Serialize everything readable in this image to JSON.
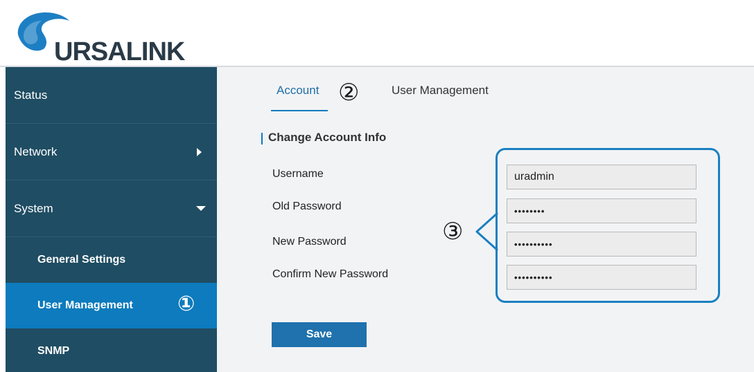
{
  "brand": {
    "logo_text": "URSALINK"
  },
  "sidebar": {
    "items": [
      {
        "label": "Status"
      },
      {
        "label": "Network"
      },
      {
        "label": "System"
      },
      {
        "label": "General Settings"
      },
      {
        "label": "User Management"
      },
      {
        "label": "SNMP"
      }
    ],
    "marker": "①"
  },
  "tabs": {
    "items": [
      {
        "label": "Account"
      },
      {
        "label": "User Management"
      }
    ],
    "marker": "②"
  },
  "account_form": {
    "title": "Change Account Info",
    "fields": [
      {
        "label": "Username",
        "value": "uradmin"
      },
      {
        "label": "Old Password",
        "value": "••••••••"
      },
      {
        "label": "New Password",
        "value": "••••••••••"
      },
      {
        "label": "Confirm New Password",
        "value": "••••••••••"
      }
    ],
    "marker": "③",
    "save_label": "Save"
  },
  "colors": {
    "sidebar_bg": "#1f4d63",
    "active_item": "#0d7bbd",
    "accent": "#1a7fc1",
    "button": "#1f72ad"
  }
}
